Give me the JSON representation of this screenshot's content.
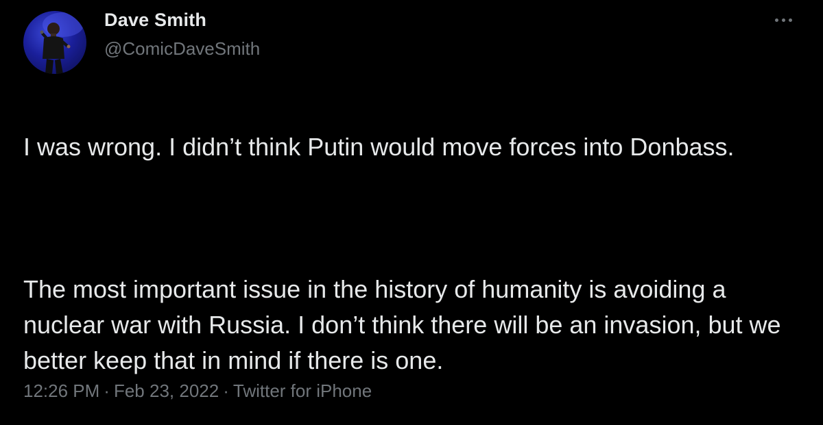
{
  "author": {
    "display_name": "Dave Smith",
    "handle": "@ComicDaveSmith"
  },
  "more_icon": "more-dots-icon",
  "tweet": {
    "paragraphs": [
      "I was wrong. I didn’t think Putin would move forces into Donbass.",
      "The most important issue in the history of humanity is avoiding a nuclear war with Russia. I don’t think there will be an invasion, but we better keep that in mind if there is one."
    ]
  },
  "meta": {
    "time": "12:26 PM",
    "date": "Feb 23, 2022",
    "source": "Twitter for iPhone",
    "separator": "·"
  },
  "colors": {
    "background": "#000000",
    "text_primary": "#e7e9ea",
    "text_secondary": "#71767b",
    "avatar_bg": "#1a1f9a"
  }
}
